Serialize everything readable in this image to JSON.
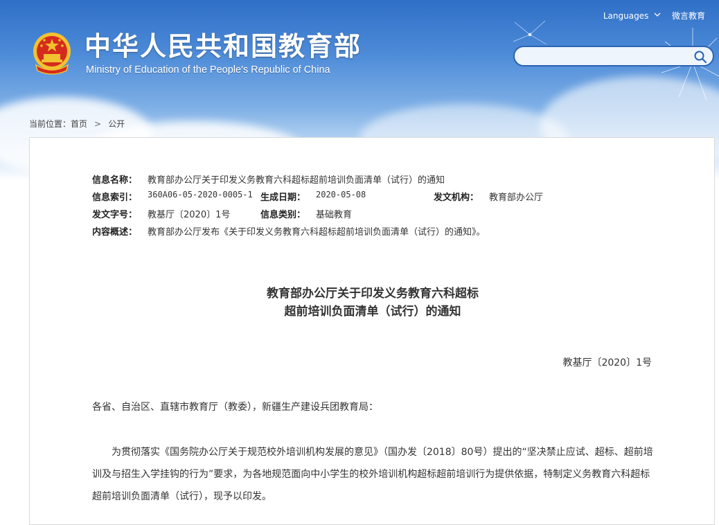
{
  "header": {
    "title_cn": "中华人民共和国教育部",
    "title_en": "Ministry of Education of the People's Republic of China",
    "languages_label": "Languages",
    "weibo_label": "微言教育",
    "search": {
      "placeholder": ""
    }
  },
  "breadcrumb": {
    "prefix": "当前位置：",
    "home": "首页",
    "separator": ">",
    "current": "公开"
  },
  "meta": {
    "info_name_label": "信息名称：",
    "info_name": "教育部办公厅关于印发义务教育六科超标超前培训负面清单（试行）的通知",
    "index_label": "信息索引：",
    "index": "360A06-05-2020-0005-1",
    "date_label": "生成日期：",
    "date": "2020-05-08",
    "issuer_label": "发文机构：",
    "issuer": "教育部办公厅",
    "doc_no_label": "发文字号：",
    "doc_no": "教基厅〔2020〕1号",
    "category_label": "信息类别：",
    "category": "基础教育",
    "summary_label": "内容概述：",
    "summary": "教育部办公厅发布《关于印发义务教育六科超标超前培训负面清单（试行）的通知》。"
  },
  "document": {
    "title_line1": "教育部办公厅关于印发义务教育六科超标",
    "title_line2": "超前培训负面清单（试行）的通知",
    "number": "教基厅〔2020〕1号",
    "addressee": "各省、自治区、直辖市教育厅（教委），新疆生产建设兵团教育局：",
    "paragraph1": "为贯彻落实《国务院办公厅关于规范校外培训机构发展的意见》（国办发〔2018〕80号）提出的“坚决禁止应试、超标、超前培训及与招生入学挂钩的行为”要求，为各地规范面向中小学生的校外培训机构超标超前培训行为提供依据，特制定义务教育六科超标超前培训负面清单（试行），现予以印发。"
  },
  "colors": {
    "header_blue": "#2f6fc6",
    "search_border": "#2a63b3",
    "emblem_red": "#d52b1e",
    "emblem_gold": "#f2c230"
  }
}
